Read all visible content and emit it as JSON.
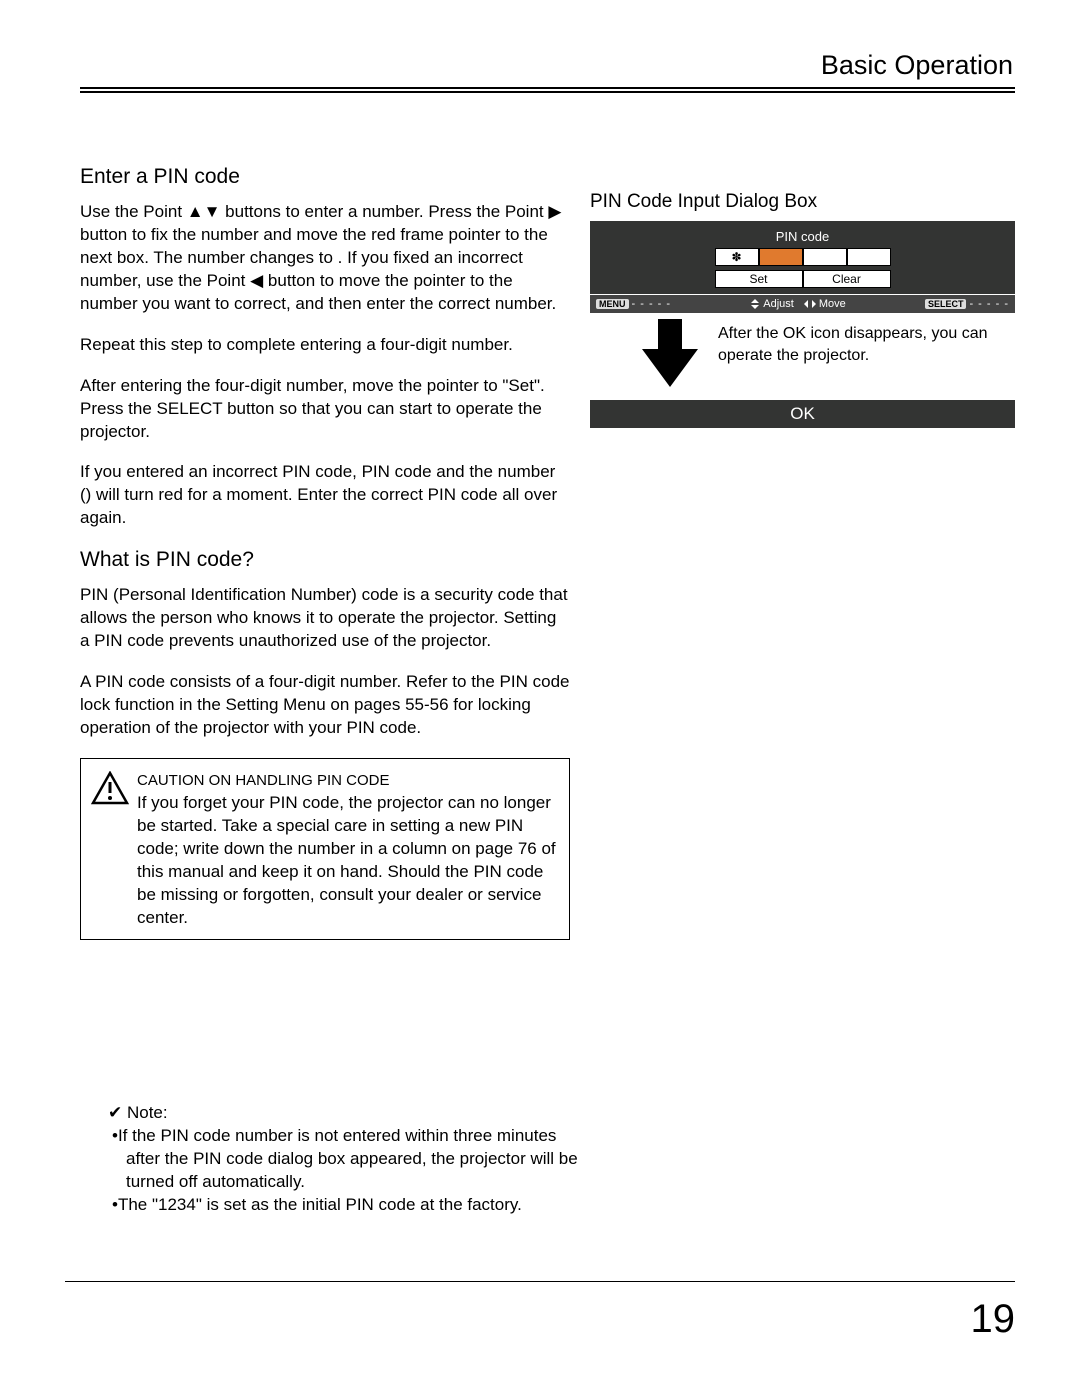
{
  "header": {
    "title": "Basic Operation"
  },
  "left": {
    "h1": "Enter a PIN code",
    "p1": "Use the Point ▲▼ buttons to enter a number. Press the Point ▶ button to fix the number and move the red frame pointer to the next box. The number changes to . If you fixed an incorrect number, use the Point ◀ button to move the pointer to the number you want to correct, and then enter the correct number.",
    "p2": "Repeat this step to complete entering a four-digit number.",
    "p3": "After entering the four-digit number, move the pointer to \"Set\". Press the SELECT button so that you can start to operate the projector.",
    "p4": "If you entered an incorrect PIN code, PIN code and the number () will turn red for a moment. Enter the correct PIN code all over again.",
    "h2": "What is PIN code?",
    "p5": "PIN (Personal Identification Number) code is a security code that allows the person who knows it to operate the projector. Setting a PIN code prevents unauthorized use of the projector.",
    "p6": "A PIN code consists of a four-digit number. Refer to the PIN code lock function in the Setting Menu on pages 55-56 for locking operation of the projector with your PIN code.",
    "caution_title": "CAUTION ON HANDLING PIN CODE",
    "caution_body": "If you forget your PIN code, the projector can no longer be started. Take a special care in setting a new PIN code; write down the number in a column on page 76 of this manual and keep it on hand. Should the PIN code be missing or forgotten, consult your dealer or service center."
  },
  "right": {
    "caption": "PIN Code Input Dialog Box",
    "pin_label": "PIN code",
    "cell1": "✽",
    "set": "Set",
    "clear": "Clear",
    "menu_tag": "MENU",
    "dashes": "- - - - -",
    "adjust": "Adjust",
    "move": "Move",
    "select_tag": "SELECT",
    "after": "After the OK icon disappears, you can operate the projector.",
    "ok": "OK"
  },
  "notes": {
    "lead": "✔ Note:",
    "n1": "•If the PIN code number is not entered within three minutes after the PIN code dialog box appeared, the projector will be turned off automatically.",
    "n2": "•The \"1234\" is set as the initial PIN code at the factory."
  },
  "page_number": "19"
}
